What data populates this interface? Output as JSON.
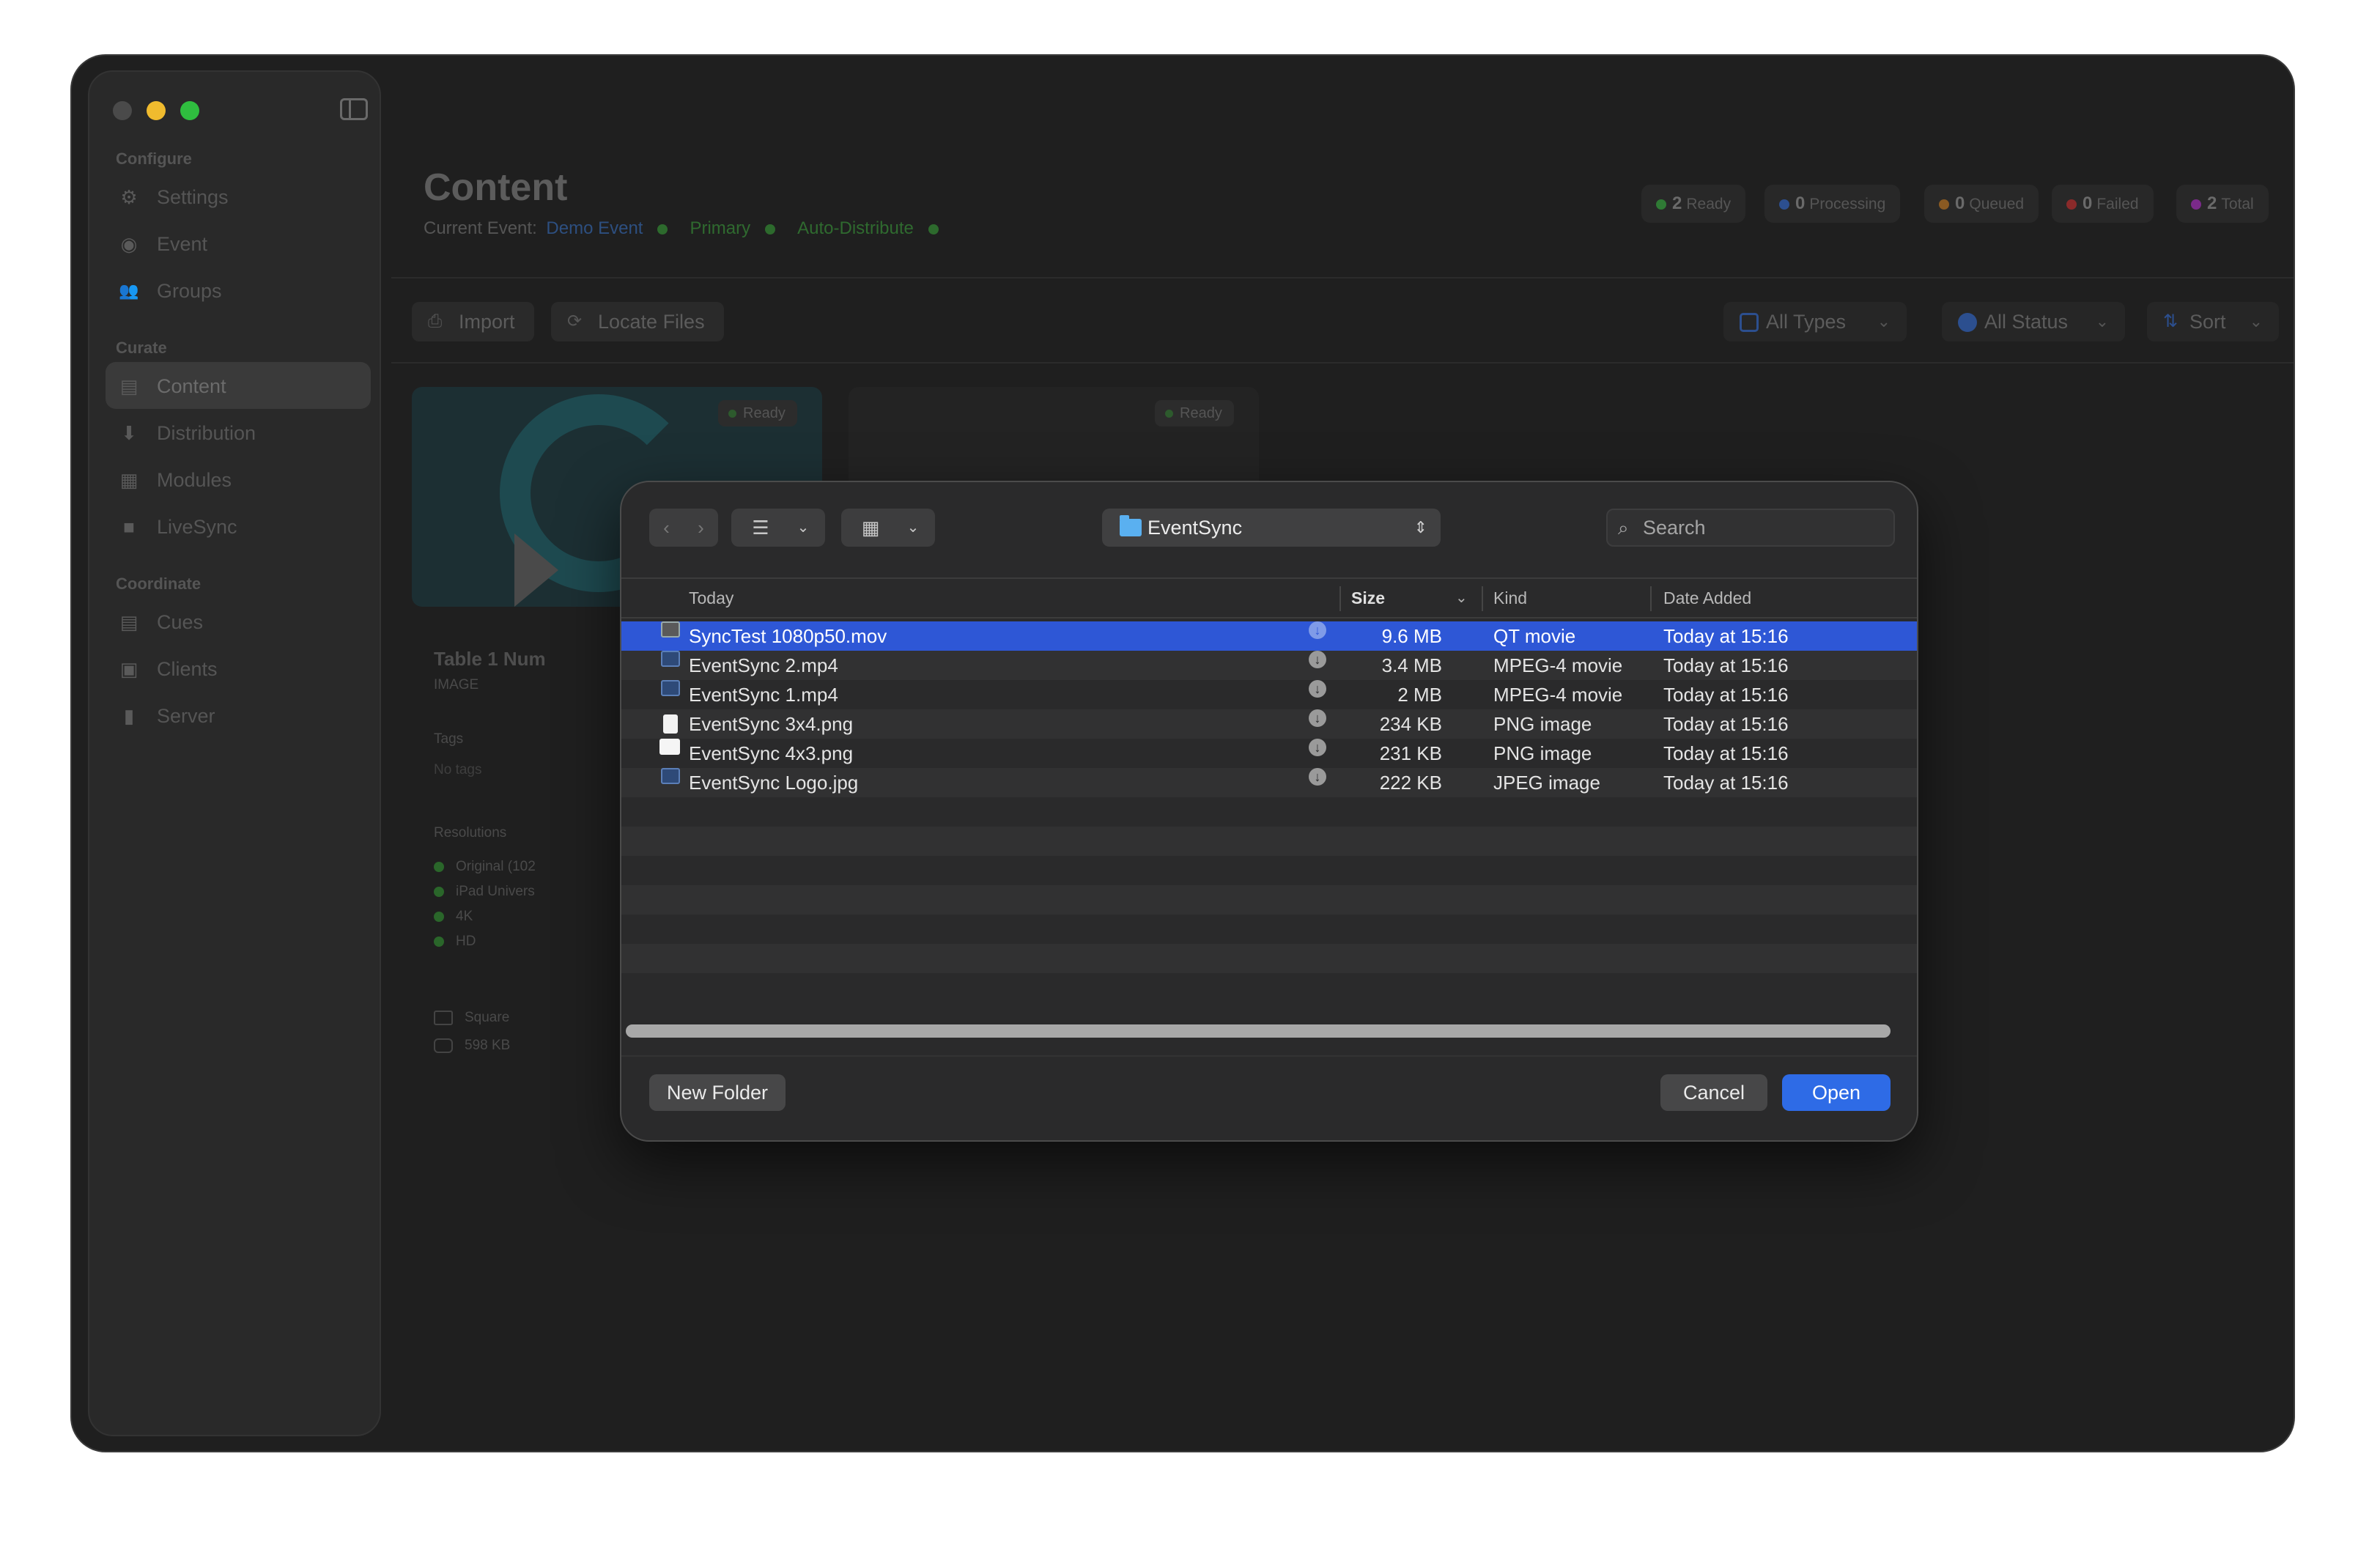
{
  "sidebar": {
    "sections": [
      {
        "label": "Configure",
        "items": [
          {
            "label": "Settings",
            "icon": "gear-icon"
          },
          {
            "label": "Event",
            "icon": "event-icon"
          },
          {
            "label": "Groups",
            "icon": "groups-icon"
          }
        ]
      },
      {
        "label": "Curate",
        "items": [
          {
            "label": "Content",
            "icon": "content-icon",
            "active": true
          },
          {
            "label": "Distribution",
            "icon": "distribution-icon"
          },
          {
            "label": "Modules",
            "icon": "modules-icon"
          },
          {
            "label": "LiveSync",
            "icon": "camera-icon"
          }
        ]
      },
      {
        "label": "Coordinate",
        "items": [
          {
            "label": "Cues",
            "icon": "cues-icon"
          },
          {
            "label": "Clients",
            "icon": "clients-icon"
          },
          {
            "label": "Server",
            "icon": "server-icon"
          }
        ]
      }
    ]
  },
  "header": {
    "title": "Content",
    "current_event_label": "Current Event:",
    "event_name": "Demo Event",
    "primary": "Primary",
    "auto_distribute": "Auto-Distribute"
  },
  "status_pills": [
    {
      "count": "2",
      "label": "Ready",
      "color": "#2f7a35"
    },
    {
      "count": "0",
      "label": "Processing",
      "color": "#2c4f8f"
    },
    {
      "count": "0",
      "label": "Queued",
      "color": "#8a5a22"
    },
    {
      "count": "0",
      "label": "Failed",
      "color": "#8a2a2a"
    },
    {
      "count": "2",
      "label": "Total",
      "color": "#7a2a8a"
    }
  ],
  "toolbar": {
    "import_label": "Import",
    "locate_label": "Locate Files",
    "all_types": "All Types",
    "all_status": "All Status",
    "sort": "Sort"
  },
  "cards": [
    {
      "badge": "Ready"
    },
    {
      "badge": "Ready"
    }
  ],
  "detail": {
    "title": "Table 1 Num",
    "type": "IMAGE",
    "tags_label": "Tags",
    "tags_value": "No tags",
    "resolutions_label": "Resolutions",
    "resolutions": [
      "Original (102",
      "iPad Univers",
      "4K",
      "HD"
    ],
    "shape": "Square",
    "size": "598 KB"
  },
  "dialog": {
    "location": "EventSync",
    "search_placeholder": "Search",
    "columns": {
      "name": "Today",
      "size": "Size",
      "kind": "Kind",
      "date": "Date Added"
    },
    "files": [
      {
        "name": "SyncTest 1080p50.mov",
        "size": "9.6 MB",
        "kind": "QT movie",
        "date": "Today at 15:16",
        "icon": "movie-file-icon",
        "selected": true
      },
      {
        "name": "EventSync 2.mp4",
        "size": "3.4 MB",
        "kind": "MPEG-4 movie",
        "date": "Today at 15:16",
        "icon": "video-file-icon"
      },
      {
        "name": "EventSync 1.mp4",
        "size": "2 MB",
        "kind": "MPEG-4 movie",
        "date": "Today at 15:16",
        "icon": "video-file-icon"
      },
      {
        "name": "EventSync 3x4.png",
        "size": "234 KB",
        "kind": "PNG image",
        "date": "Today at 15:16",
        "icon": "png-file-icon"
      },
      {
        "name": "EventSync 4x3.png",
        "size": "231 KB",
        "kind": "PNG image",
        "date": "Today at 15:16",
        "icon": "png-file-icon"
      },
      {
        "name": "EventSync Logo.jpg",
        "size": "222 KB",
        "kind": "JPEG image",
        "date": "Today at 15:16",
        "icon": "jpeg-file-icon"
      }
    ],
    "new_folder": "New Folder",
    "cancel": "Cancel",
    "open": "Open"
  }
}
